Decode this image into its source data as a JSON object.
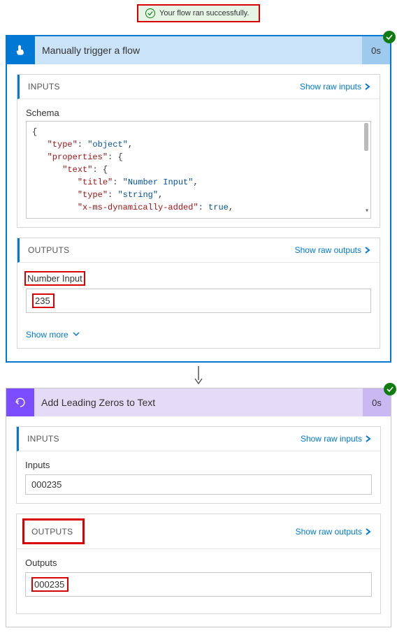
{
  "banner": {
    "text": "Your flow ran successfully."
  },
  "card1": {
    "title": "Manually trigger a flow",
    "time": "0s",
    "inputs": {
      "title": "INPUTS",
      "link": "Show raw inputs",
      "schema_label": "Schema",
      "schema_lines": [
        {
          "type": "brace",
          "text": "{"
        },
        {
          "indent": 1,
          "key": "type",
          "val": "object",
          "comma": true
        },
        {
          "indent": 1,
          "key": "properties",
          "brace": "{"
        },
        {
          "indent": 2,
          "key": "text",
          "brace": "{"
        },
        {
          "indent": 3,
          "key": "title",
          "val": "Number Input",
          "comma": true
        },
        {
          "indent": 3,
          "key": "type",
          "val": "string",
          "comma": true
        },
        {
          "indent": 3,
          "key": "x-ms-dynamically-added",
          "bool": "true",
          "comma": true
        }
      ]
    },
    "outputs": {
      "title": "OUTPUTS",
      "link": "Show raw outputs",
      "field_label": "Number Input",
      "field_value": "235",
      "show_more": "Show more"
    }
  },
  "card2": {
    "title": "Add Leading Zeros to Text",
    "time": "0s",
    "inputs": {
      "title": "INPUTS",
      "link": "Show raw inputs",
      "field_label": "Inputs",
      "field_value": "000235"
    },
    "outputs": {
      "title": "OUTPUTS",
      "link": "Show raw outputs",
      "field_label": "Outputs",
      "field_value": "000235"
    }
  }
}
